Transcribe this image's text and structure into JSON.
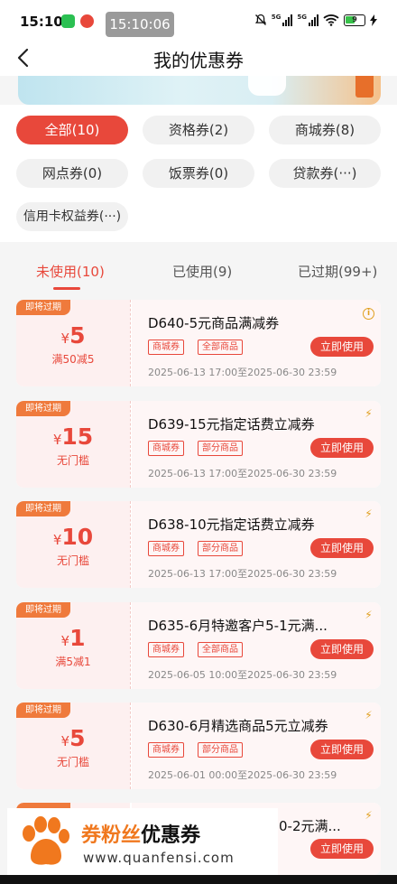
{
  "status_bar": {
    "time": "15:10",
    "overlay_time": "15:10:06",
    "battery": "9",
    "net_labels": [
      "5G",
      "5G"
    ]
  },
  "header": {
    "title": "我的优惠券"
  },
  "filters": [
    {
      "label": "全部(10)",
      "active": true
    },
    {
      "label": "资格券(2)",
      "active": false
    },
    {
      "label": "商城券(8)",
      "active": false
    },
    {
      "label": "网点券(0)",
      "active": false
    },
    {
      "label": "饭票券(0)",
      "active": false
    },
    {
      "label": "贷款券(···)",
      "active": false
    },
    {
      "label": "信用卡权益券(···)",
      "active": false
    }
  ],
  "tabs": [
    {
      "label": "未使用(10)",
      "active": true
    },
    {
      "label": "已使用(9)",
      "active": false
    },
    {
      "label": "已过期(99+)",
      "active": false
    }
  ],
  "coupons": [
    {
      "badge": "即将过期",
      "yen": "¥",
      "amount": "5",
      "condition": "满50减5",
      "title": "D640-5元商品满减券",
      "tags": [
        "商城券",
        "全部商品"
      ],
      "date": "2025-06-13 17:00至2025-06-30 23:59",
      "button": "立即使用"
    },
    {
      "badge": "即将过期",
      "yen": "¥",
      "amount": "15",
      "condition": "无门槛",
      "title": "D639-15元指定话费立减券",
      "tags": [
        "商城券",
        "部分商品"
      ],
      "date": "2025-06-13 17:00至2025-06-30 23:59",
      "button": "立即使用"
    },
    {
      "badge": "即将过期",
      "yen": "¥",
      "amount": "10",
      "condition": "无门槛",
      "title": "D638-10元指定话费立减券",
      "tags": [
        "商城券",
        "部分商品"
      ],
      "date": "2025-06-13 17:00至2025-06-30 23:59",
      "button": "立即使用"
    },
    {
      "badge": "即将过期",
      "yen": "¥",
      "amount": "1",
      "condition": "满5减1",
      "title": "D635-6月特邀客户5-1元满...",
      "tags": [
        "商城券",
        "全部商品"
      ],
      "date": "2025-06-05 10:00至2025-06-30 23:59",
      "button": "立即使用"
    },
    {
      "badge": "即将过期",
      "yen": "¥",
      "amount": "5",
      "condition": "无门槛",
      "title": "D630-6月精选商品5元立减券",
      "tags": [
        "商城券",
        "部分商品"
      ],
      "date": "2025-06-01 00:00至2025-06-30 23:59",
      "button": "立即使用"
    }
  ],
  "partial_coupon": {
    "title": "0-2元满...",
    "button": "立即使用"
  },
  "watermark": {
    "name_a": "券粉丝",
    "name_b": "优惠券",
    "url": "www.quanfensi.com"
  },
  "colors": {
    "accent": "#e8483b",
    "badge": "#ef7a3c",
    "brand_orange": "#f0781e"
  }
}
